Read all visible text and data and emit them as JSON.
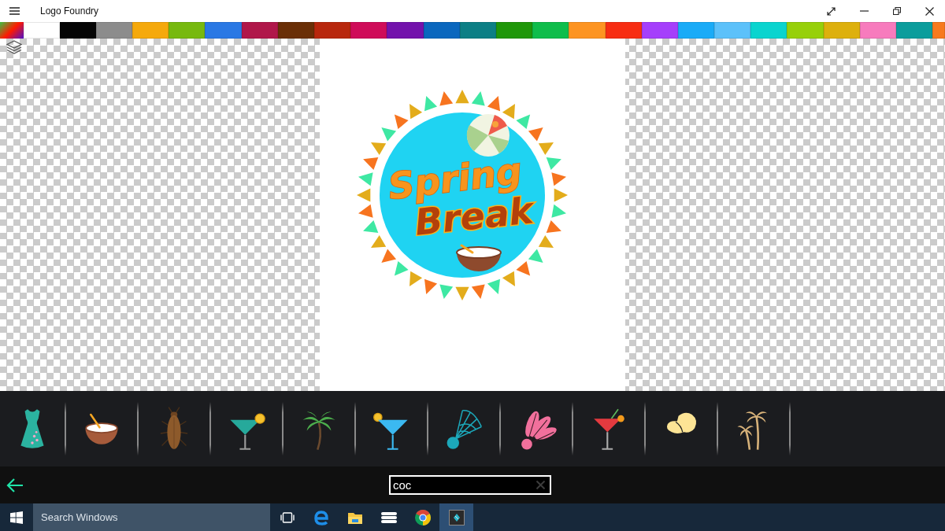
{
  "window": {
    "title": "Logo Foundry"
  },
  "palette": [
    {
      "kind": "gradient"
    },
    {
      "kind": "solid",
      "color": "#ffffff"
    },
    {
      "kind": "solid",
      "color": "#050505"
    },
    {
      "kind": "solid",
      "color": "#8c8c8c"
    },
    {
      "kind": "solid",
      "color": "#f5a90c"
    },
    {
      "kind": "solid",
      "color": "#77b90f"
    },
    {
      "kind": "solid",
      "color": "#2a78e4"
    },
    {
      "kind": "solid",
      "color": "#b0174a"
    },
    {
      "kind": "solid",
      "color": "#6a2f07"
    },
    {
      "kind": "solid",
      "color": "#b8270d"
    },
    {
      "kind": "solid",
      "color": "#cf0c59"
    },
    {
      "kind": "solid",
      "color": "#7312ac"
    },
    {
      "kind": "solid",
      "color": "#0a67be"
    },
    {
      "kind": "solid",
      "color": "#0c7f85"
    },
    {
      "kind": "solid",
      "color": "#1f9709"
    },
    {
      "kind": "solid",
      "color": "#0fbd4b"
    },
    {
      "kind": "solid",
      "color": "#fd9421"
    },
    {
      "kind": "solid",
      "color": "#f72d12"
    },
    {
      "kind": "solid",
      "color": "#a53ffb"
    },
    {
      "kind": "solid",
      "color": "#1aabf7"
    },
    {
      "kind": "solid",
      "color": "#5cc1fa"
    },
    {
      "kind": "solid",
      "color": "#0ad4cf"
    },
    {
      "kind": "solid",
      "color": "#97d00a"
    },
    {
      "kind": "solid",
      "color": "#ddb00d"
    },
    {
      "kind": "solid",
      "color": "#f77bbd"
    },
    {
      "kind": "solid",
      "color": "#0b9d9c"
    },
    {
      "kind": "solid",
      "color": "#f77a1e"
    }
  ],
  "canvas": {
    "logo": {
      "text_line_1": "Spring",
      "text_line_2": "Break"
    }
  },
  "clipart_search": {
    "value": "coc"
  },
  "taskbar": {
    "search": {
      "placeholder": "Search Windows"
    },
    "apps": [
      {
        "selected": false
      },
      {
        "selected": false
      },
      {
        "selected": false
      },
      {
        "selected": false
      },
      {
        "selected": false
      },
      {
        "selected": true
      }
    ]
  }
}
